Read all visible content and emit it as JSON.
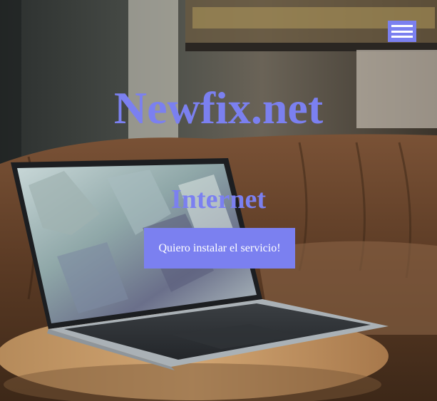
{
  "header": {
    "menu_icon": "hamburger-menu-icon",
    "site_title": "Newfix.net"
  },
  "hero": {
    "heading": "Internet",
    "cta_label": "Quiero instalar el servicio!",
    "background_image": "laptop on wooden table in front of brown leather sofa"
  },
  "colors": {
    "accent": "#7b80f0",
    "button_text": "#ffffff"
  }
}
